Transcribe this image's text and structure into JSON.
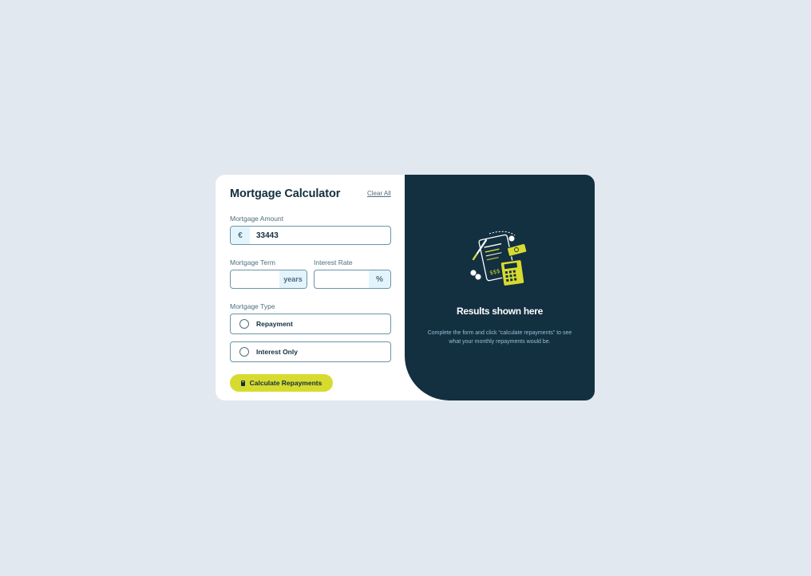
{
  "form": {
    "title": "Mortgage Calculator",
    "clear_all_label": "Clear All",
    "amount": {
      "label": "Mortgage Amount",
      "prefix": "€",
      "value": "33443"
    },
    "term": {
      "label": "Mortgage Term",
      "suffix": "years",
      "value": ""
    },
    "rate": {
      "label": "Interest Rate",
      "suffix": "%",
      "value": ""
    },
    "type": {
      "label": "Mortgage Type",
      "options": [
        {
          "label": "Repayment",
          "selected": false
        },
        {
          "label": "Interest Only",
          "selected": false
        }
      ]
    },
    "submit_label": "Calculate Repayments",
    "submit_icon": "calculator-icon"
  },
  "results": {
    "illustration": "empty-results-illustration",
    "title": "Results shown here",
    "description": "Complete the form and click “calculate repayments” to see what your monthly repayments would be."
  },
  "colors": {
    "page_bg": "#e1e8ef",
    "card_bg": "#ffffff",
    "results_bg": "#133041",
    "accent_lime": "#d8db2f",
    "text_dark": "#122f3f",
    "text_muted": "#4e6e7e",
    "addon_bg": "#e3f4fc"
  }
}
